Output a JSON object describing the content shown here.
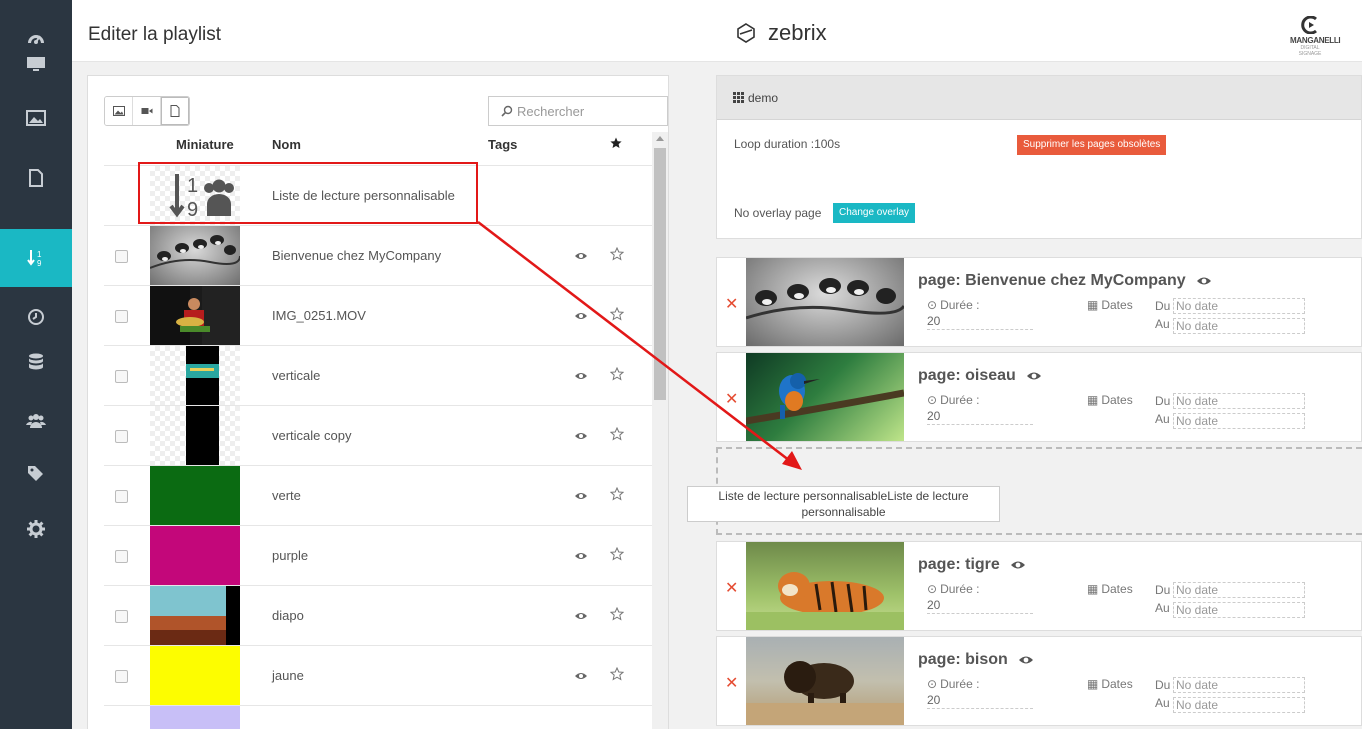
{
  "header": {
    "title": "Editer la playlist",
    "brand": "zebrix",
    "partner_logo": {
      "name": "MANGANELLI",
      "tagline": "DIGITAL SIGNAGE"
    }
  },
  "sidebar": {
    "items": [
      {
        "icon": "dashboard-icon"
      },
      {
        "icon": "monitor-icon"
      },
      {
        "icon": "image-icon"
      },
      {
        "icon": "file-icon"
      },
      {
        "icon": "playlist-sort-icon",
        "active": true
      },
      {
        "icon": "clock-icon"
      },
      {
        "icon": "database-icon"
      },
      {
        "icon": "users-icon"
      },
      {
        "icon": "tags-icon"
      },
      {
        "icon": "gear-icon"
      }
    ]
  },
  "library": {
    "search_placeholder": "Rechercher",
    "columns": {
      "thumbnail": "Miniature",
      "name": "Nom",
      "tags": "Tags"
    },
    "rows": [
      {
        "name": "Liste de lecture personnalisable",
        "thumb": "playlist"
      },
      {
        "name": "Bienvenue chez MyCompany",
        "thumb": "birds"
      },
      {
        "name": "IMG_0251.MOV",
        "thumb": "video"
      },
      {
        "name": "verticale",
        "thumb": "vertical"
      },
      {
        "name": "verticale copy",
        "thumb": "vertical-black"
      },
      {
        "name": "verte",
        "thumb": "green",
        "color": "#0b6b12"
      },
      {
        "name": "purple",
        "thumb": "purple",
        "color": "#c3077a"
      },
      {
        "name": "diapo",
        "thumb": "diapo"
      },
      {
        "name": "jaune",
        "thumb": "yellow",
        "color": "#fdfd00"
      },
      {
        "name": "",
        "thumb": "lavender",
        "color": "#c8bff7"
      }
    ]
  },
  "playlist": {
    "name": "demo",
    "loop_duration": "Loop duration :100s",
    "delete_obsolete_label": "Supprimer les pages obsolètes",
    "overlay_text": "No overlay page",
    "change_overlay_label": "Change overlay",
    "duration_label": "Durée :",
    "dates_label": "Dates",
    "from_label": "Du",
    "to_label": "Au",
    "pages": [
      {
        "title": "page: Bienvenue chez MyCompany",
        "duration": "20",
        "from": "No date",
        "to": "No date",
        "thumb": "birds"
      },
      {
        "title": "page: oiseau",
        "duration": "20",
        "from": "No date",
        "to": "No date",
        "thumb": "kingfisher"
      },
      {
        "title": "page: tigre",
        "duration": "20",
        "from": "No date",
        "to": "No date",
        "thumb": "tiger"
      },
      {
        "title": "page: bison",
        "duration": "20",
        "from": "No date",
        "to": "No date",
        "thumb": "bison"
      }
    ],
    "drag_tooltip": "Liste de lecture personnalisableListe de lecture personnalisable"
  },
  "colors": {
    "sidebar_bg": "#2b3641",
    "accent_teal": "#1ab8c4",
    "danger_red": "#e95b3c",
    "annotation_red": "#e21818"
  }
}
